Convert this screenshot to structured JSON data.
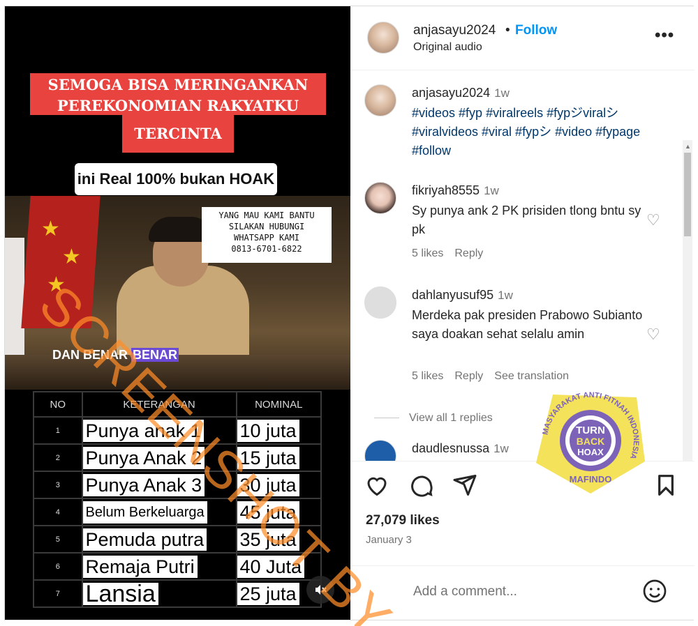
{
  "video": {
    "banner_line1": "SEMOGA BISA MERINGANKAN",
    "banner_line2": "PEREKONOMIAN RAKYATKU",
    "banner_line3": "TERCINTA",
    "white_label": "ini Real 100% bukan HOAK",
    "contact_line1": "YANG MAU KAMI BANTU",
    "contact_line2": "SILAKAN HUBUNGI",
    "contact_line3": "WHATSAPP KAMI",
    "contact_line4": "0813-6701-6822",
    "subtitle_a": "DAN BENAR ",
    "subtitle_b": "BENAR",
    "table": {
      "headers": [
        "NO",
        "KETERANGAN",
        "NOMINAL"
      ],
      "rows": [
        {
          "no": "1",
          "ket": "Punya anak 1",
          "nom": "10 juta"
        },
        {
          "no": "2",
          "ket": "Punya Anak 2",
          "nom": "15 juta"
        },
        {
          "no": "3",
          "ket": "Punya Anak 3",
          "nom": "30 juta"
        },
        {
          "no": "4",
          "ket": "Belum Berkeluarga",
          "nom": "45 juta"
        },
        {
          "no": "5",
          "ket": "Pemuda putra",
          "nom": "35 juta"
        },
        {
          "no": "6",
          "ket": "Remaja Putri",
          "nom": "40 Juta"
        },
        {
          "no": "7",
          "ket": "Lansia",
          "nom": "25 juta"
        }
      ]
    },
    "mute_icon": "speaker-muted-icon"
  },
  "header": {
    "username": "anjasayu2024",
    "separator": "•",
    "follow_label": "Follow",
    "audio": "Original audio",
    "more": "•••"
  },
  "comments": [
    {
      "user": "anjasayu2024",
      "time": "1w",
      "text": "#videos #fyp #viralreels #fypジviralシ #viralvideos #viral #fypシ #video #fypage #follow"
    },
    {
      "user": "fikriyah8555",
      "time": "1w",
      "text": "Sy punya ank 2 PK prisiden tlong bntu sy pk",
      "likes": "5 likes",
      "reply": "Reply"
    },
    {
      "user": "dahlanyusuf95",
      "time": "1w",
      "text": "Merdeka pak presiden Prabowo Subianto saya doakan sehat selalu amin",
      "likes": "5 likes",
      "reply": "Reply",
      "translation": "See translation"
    },
    {
      "user": "daudlesnussa",
      "time": "1w"
    }
  ],
  "view_replies": "View all 1 replies",
  "actions": {
    "likes": "27,079 likes",
    "date": "January 3"
  },
  "comment_bar": {
    "placeholder": "Add a comment..."
  },
  "watermark": "SCREENSHOT BY",
  "badge": {
    "ring_text": "MASYARAKAT ANTI FITNAH INDONESIA",
    "bottom": "MAFINDO",
    "center1": "TURN",
    "center2": "BACK",
    "center3": "HOAX"
  },
  "colors": {
    "link": "#0095f6",
    "hashtag": "#00376b",
    "banner_red": "#e8433f",
    "watermark_orange": "#ff8c28",
    "badge_yellow": "#f3e25a",
    "badge_purple": "#7d63b8"
  }
}
